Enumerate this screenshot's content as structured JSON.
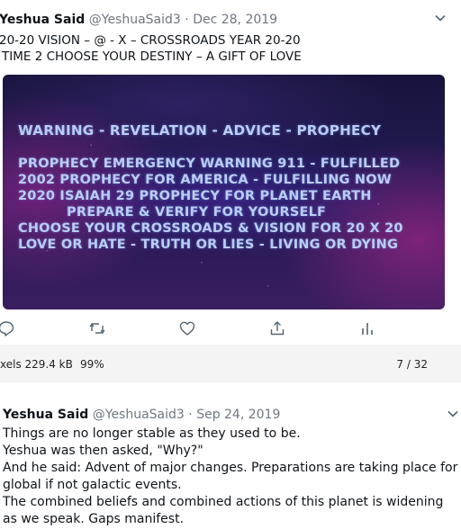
{
  "tweet1": {
    "author": "Yeshua Said",
    "handle": "@YeshuaSaid3",
    "dot": "·",
    "date": "Dec 28, 2019",
    "line1": "20-20 VISION – @ - X – CROSSROADS YEAR 20-20",
    "line2": "TIME 2 CHOOSE YOUR DESTINY – A GIFT OF LOVE",
    "image_text": {
      "heading": "WARNING - REVELATION - ADVICE - PROPHECY",
      "l1": "PROPHECY EMERGENCY WARNING 911 - FULFILLED",
      "l2": "2002 PROPHECY FOR AMERICA - FULFILLING NOW",
      "l3": "2020 ISAIAH 29 PROPHECY FOR PLANET EARTH",
      "l4": "PREPARE & VERIFY FOR YOURSELF",
      "l5": "CHOOSE YOUR CROSSROADS & VISION FOR 20 X 20",
      "l6": "LOVE OR HATE - TRUTH OR LIES -  LIVING OR DYING"
    },
    "actions": [
      "reply-icon",
      "retweet-icon",
      "like-icon",
      "share-icon",
      "analytics-icon"
    ]
  },
  "statusbar": {
    "size_text": "xels  229.4 kB",
    "zoom": "99%",
    "page": "7 / 32"
  },
  "tweet2": {
    "author": "Yeshua Said",
    "handle": "@YeshuaSaid3",
    "dot": "·",
    "date": "Sep 24, 2019",
    "lines": [
      "Things are no longer stable as they used to be.",
      "Yeshua was then asked, \"Why?\"",
      "And he said: Advent of major changes. Preparations are taking place for",
      "global if not galactic events.",
      "The combined beliefs and combined actions of this planet is widening",
      "as we speak. Gaps manifest."
    ]
  },
  "colors": {
    "poster_text": "#b9cdf4",
    "muted_text": "#6e7780",
    "icon": "#536471"
  }
}
